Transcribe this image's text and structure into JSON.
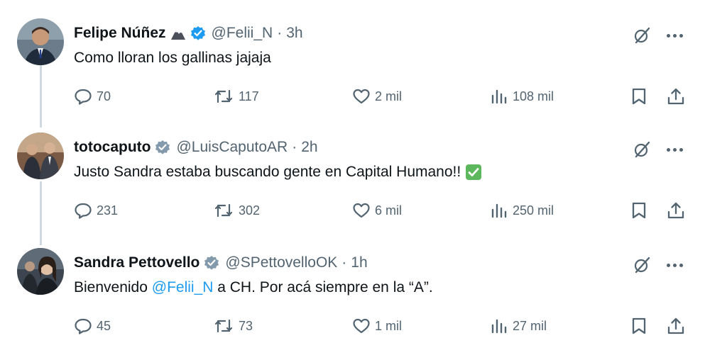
{
  "tweets": [
    {
      "name": "Felipe Núñez",
      "handle": "@Felii_N",
      "time": "3h",
      "verified": "blue",
      "has_emoji": true,
      "text_parts": [
        "Como lloran los gallinas jajaja"
      ],
      "mention": "",
      "text_after": "",
      "has_check": false,
      "stats": {
        "replies": "70",
        "retweets": "117",
        "likes": "2 mil",
        "views": "108 mil"
      }
    },
    {
      "name": "totocaputo",
      "handle": "@LuisCaputoAR",
      "time": "2h",
      "verified": "gray",
      "has_emoji": false,
      "text_parts": [
        "Justo Sandra estaba buscando gente en Capital Humano!!"
      ],
      "mention": "",
      "text_after": "",
      "has_check": true,
      "stats": {
        "replies": "231",
        "retweets": "302",
        "likes": "6 mil",
        "views": "250 mil"
      }
    },
    {
      "name": "Sandra Pettovello",
      "handle": "@SPettovelloOK",
      "time": "1h",
      "verified": "gray",
      "has_emoji": false,
      "text_parts": [
        "Bienvenido "
      ],
      "mention": "@Felii_N",
      "text_after": " a CH. Por acá siempre en la “A”.",
      "has_check": false,
      "stats": {
        "replies": "45",
        "retweets": "73",
        "likes": "1 mil",
        "views": "27 mil"
      }
    }
  ],
  "separator": "·",
  "colors": {
    "text": "#0f1419",
    "muted": "#536471",
    "link": "#1d9bf0",
    "verified_blue": "#1d9bf0",
    "verified_gray": "#829aab",
    "thread_line": "#cfd9de",
    "check_green": "#5db75d"
  },
  "icons": [
    "reply-icon",
    "retweet-icon",
    "like-icon",
    "views-icon",
    "bookmark-icon",
    "share-icon",
    "grok-icon",
    "more-icon",
    "verified-icon",
    "emoji-icon",
    "checkmark-emoji"
  ]
}
